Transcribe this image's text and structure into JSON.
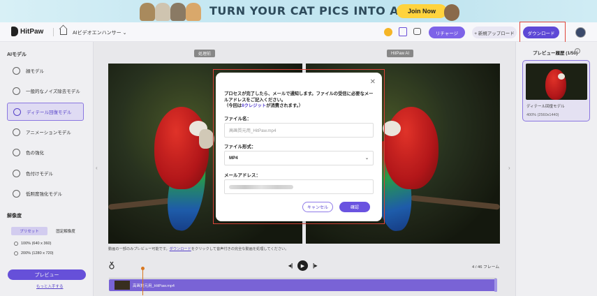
{
  "banner": {
    "headline": "TURN YOUR CAT PICS INTO A DJI",
    "cta": "Join Now"
  },
  "header": {
    "app_name": "HitPaw",
    "breadcrumb": "AIビデオエンハンサー",
    "charge_label": "リチャージ",
    "upload_label": "+ 新規アップロード",
    "download_label": "ダウンロード"
  },
  "sidebar": {
    "title": "AIモデル",
    "models": [
      {
        "label": "顔モデル"
      },
      {
        "label": "一般的なノイズ除去モデル"
      },
      {
        "label": "ディテール回復モデル"
      },
      {
        "label": "アニメーションモデル"
      },
      {
        "label": "色の強化"
      },
      {
        "label": "色付けモデル"
      },
      {
        "label": "低照度強化モデル"
      }
    ],
    "resolution_title": "解像度",
    "res_tabs": [
      "プリセット",
      "固定解像度"
    ],
    "res_options": [
      "100% (640 x 360)",
      "200% (1280 x 720)"
    ],
    "preview_label": "プレビュー",
    "more_link": "もっと入手する"
  },
  "main": {
    "before_label": "処理前",
    "after_label": "HitPaw AI",
    "notice_pre": "動画の一部のみプレビュー可能です。",
    "notice_link": "ダウンロード",
    "notice_post": "をクリックして音声付きの完全な動画を処理してください。"
  },
  "right_panel": {
    "title": "プレビュー履歴 (1/50)",
    "item_name": "ディテール回復モデル",
    "item_res": "400% (2560x1440)"
  },
  "timeline": {
    "frames": "4 / 46 フレーム",
    "track_name": "高画質元用_HitPaw.mp4"
  },
  "modal": {
    "message_1": "プロセスが完了したら、メールで通知します。ファイルの受信に必要なメールアドレスをご記入ください。",
    "message_2_pre": "（今回は",
    "message_2_hl": "8クレジット",
    "message_2_post": "が消費されます。）",
    "filename_label": "ファイル名：",
    "filename_placeholder": "高画質元用_HitPaw.mp4",
    "format_label": "ファイル形式：",
    "format_value": "MP4",
    "email_label": "メールアドレス：",
    "cancel_label": "キャンセル",
    "confirm_label": "確認"
  },
  "colors": {
    "accent": "#6a53e0",
    "highlight_border": "#e0443a"
  }
}
